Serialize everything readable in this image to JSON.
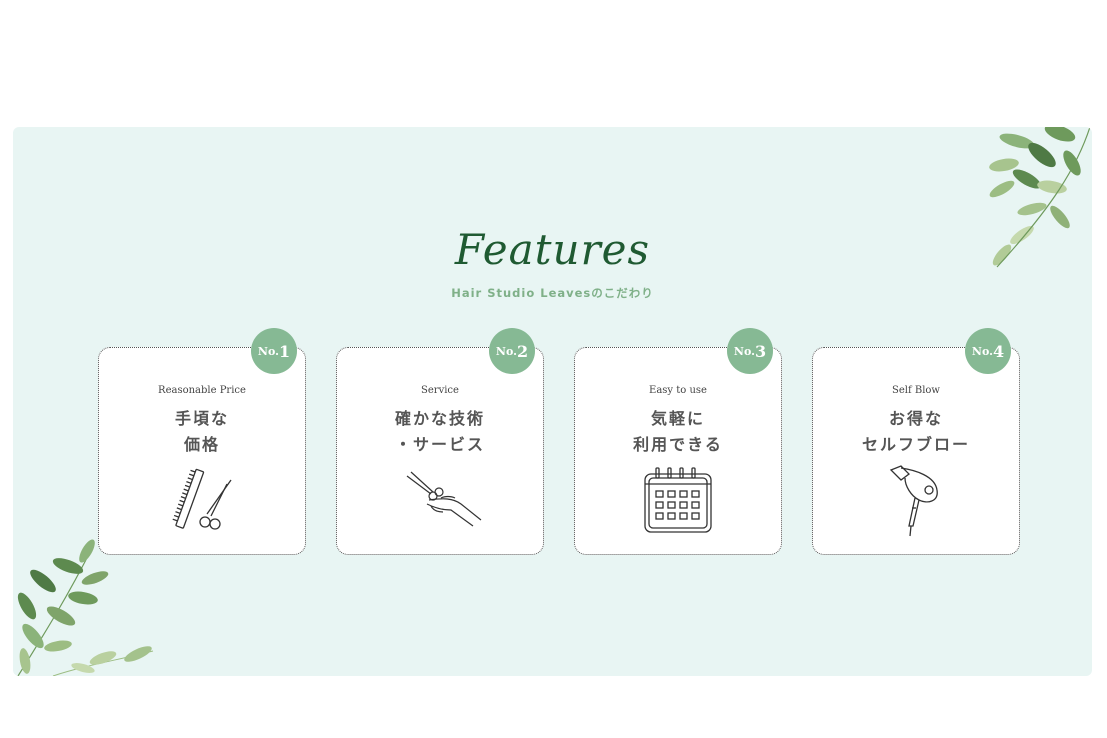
{
  "section": {
    "title": "Features",
    "subtitle": "Hair Studio Leavesのこだわり"
  },
  "features": [
    {
      "badge_prefix": "No.",
      "badge_num": "1",
      "english": "Reasonable Price",
      "line1": "手頃な",
      "line2": "価格",
      "icon": "comb-scissors-icon"
    },
    {
      "badge_prefix": "No.",
      "badge_num": "2",
      "english": "Service",
      "line1": "確かな技術",
      "line2": "・サービス",
      "icon": "hand-scissors-icon"
    },
    {
      "badge_prefix": "No.",
      "badge_num": "3",
      "english": "Easy to use",
      "line1": "気軽に",
      "line2": "利用できる",
      "icon": "calendar-icon"
    },
    {
      "badge_prefix": "No.",
      "badge_num": "4",
      "english": "Self Blow",
      "line1": "お得な",
      "line2": "セルフブロー",
      "icon": "hair-dryer-icon"
    }
  ],
  "colors": {
    "panel_bg": "#e8f5f3",
    "title": "#1f5a32",
    "subtitle": "#7fb088",
    "badge": "#86b994"
  }
}
